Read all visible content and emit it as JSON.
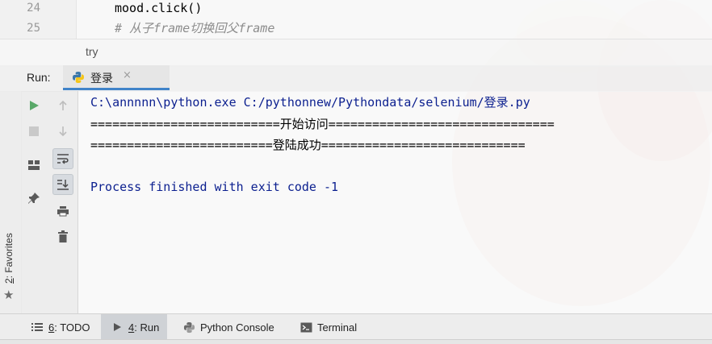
{
  "editor": {
    "lines": [
      {
        "number": "24",
        "code": "mood.click()"
      },
      {
        "number": "25",
        "code": "# 从子frame切换回父frame"
      }
    ]
  },
  "breadcrumb": {
    "text": "try"
  },
  "run_panel": {
    "label": "Run:",
    "tab_label": "登录",
    "tab_close": "×"
  },
  "console": {
    "lines": [
      "C:\\annnnn\\python.exe C:/pythonnew/Pythondata/selenium/登录.py",
      "==========================开始访问===============================",
      "=========================登陆成功============================",
      "",
      "Process finished with exit code -1"
    ]
  },
  "favorites": {
    "num": "2",
    "label": ": Favorites"
  },
  "bottom_tabs": [
    {
      "num": "6",
      "label": ": TODO"
    },
    {
      "num": "4",
      "label": ": Run"
    },
    {
      "label": "Python Console"
    },
    {
      "label": "Terminal"
    }
  ],
  "colors": {
    "run_green": "#59a869",
    "console_blue": "#0b1f8f",
    "tab_underline": "#4083c9"
  }
}
